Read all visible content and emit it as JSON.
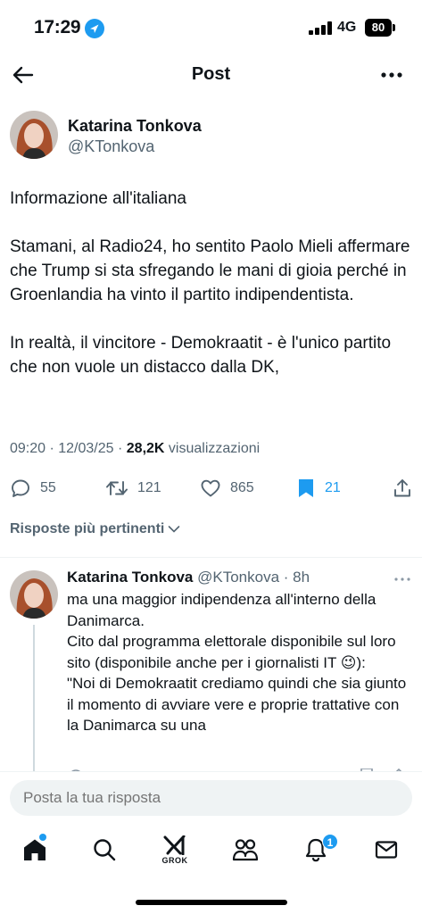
{
  "status_bar": {
    "time": "17:29",
    "network": "4G",
    "battery": "80"
  },
  "header": {
    "title": "Post"
  },
  "author": {
    "name": "Katarina Tonkova",
    "handle": "@KTonkova"
  },
  "tweet": {
    "paragraphs": [
      "Informazione all'italiana",
      "Stamani, al Radio24, ho sentito Paolo Mieli affermare che Trump si sta sfregando le mani di gioia perché in Groenlandia ha vinto il partito indipendentista.",
      "In realtà, il vincitore - Demokraatit - è l'unico partito che non vuole un distacco dalla DK,"
    ],
    "timestamp": "09:20 · 12/03/25 · ",
    "views_count": "28,2K",
    "views_label": " visualizzazioni"
  },
  "actions": {
    "replies": "55",
    "reposts": "121",
    "likes": "865",
    "bookmarks": "21"
  },
  "sort_label": "Risposte più pertinenti",
  "reply": {
    "name": "Katarina Tonkova",
    "handle": "@KTonkova",
    "time": " · 8h",
    "lines": [
      "ma una maggior indipendenza all'interno della Danimarca.",
      "Cito dal programma elettorale disponibile sul loro sito (disponibile anche per i giornalisti IT 😉):",
      "\"Noi di Demokraatit crediamo quindi che sia giunto il momento di avviare vere e proprie trattative con la Danimarca su una"
    ]
  },
  "composer": {
    "placeholder": "Posta la tua risposta"
  },
  "tabbar": {
    "grok_label": "GROK",
    "notifications_badge": "1"
  },
  "colors": {
    "accent": "#1d9bf0",
    "text": "#0f1419",
    "secondary": "#536471"
  }
}
